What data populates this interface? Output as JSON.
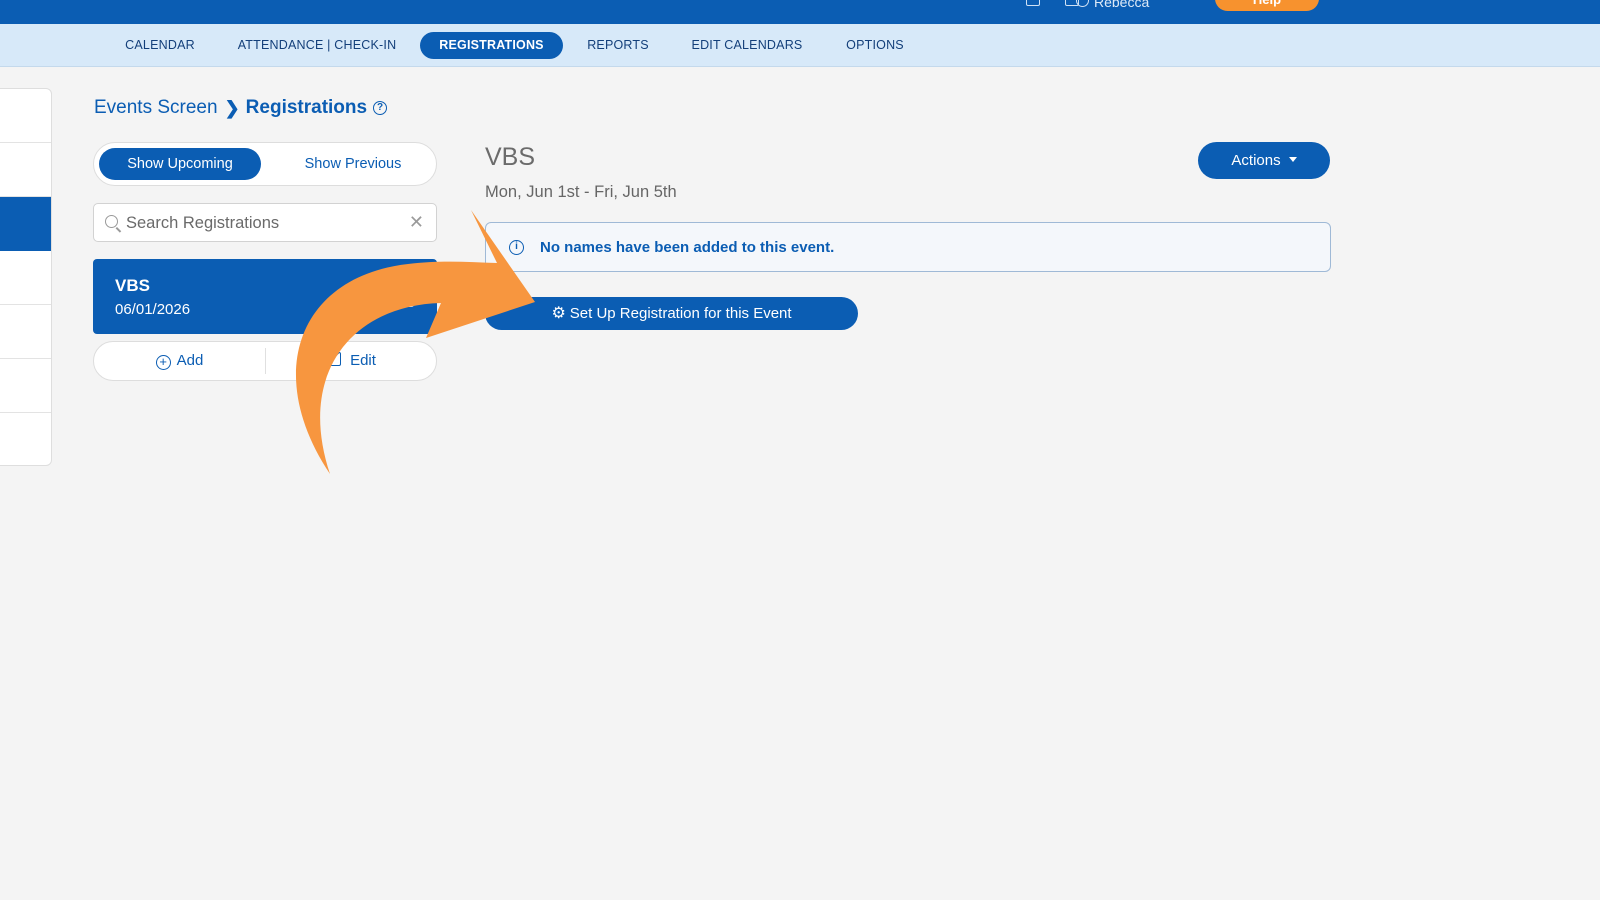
{
  "topbar": {
    "user_name": "Rebecca",
    "help_label": "Help",
    "icons": [
      "square-icon",
      "bell-icon",
      "user-icon"
    ]
  },
  "nav": {
    "tabs": [
      {
        "label": "CALENDAR"
      },
      {
        "label": "ATTENDANCE | CHECK-IN"
      },
      {
        "label": "REGISTRATIONS"
      },
      {
        "label": "REPORTS"
      },
      {
        "label": "EDIT CALENDARS"
      },
      {
        "label": "OPTIONS"
      }
    ],
    "active": "REGISTRATIONS"
  },
  "breadcrumb": {
    "parent": "Events Screen",
    "current": "Registrations",
    "help_glyph": "?"
  },
  "list": {
    "toggle": {
      "upcoming": "Show Upcoming",
      "previous": "Show Previous",
      "selected": "Show Upcoming"
    },
    "search": {
      "placeholder": "Search Registrations",
      "value": ""
    },
    "events": [
      {
        "name": "VBS",
        "date": "06/01/2026",
        "count": "0"
      }
    ],
    "add_label": "Add",
    "edit_label": "Edit"
  },
  "detail": {
    "title": "VBS",
    "dates": "Mon, Jun 1st - Fri, Jun 5th",
    "actions_label": "Actions",
    "alert": {
      "icon": "i",
      "message": "No names have been added to this event."
    },
    "setup_label": "Set Up Registration for this Event"
  },
  "colors": {
    "primary": "#0b5db3",
    "subnav": "#d7e9f9",
    "background": "#f4f4f4",
    "annotation_arrow": "#f7963f",
    "help_button": "#f7922e"
  }
}
